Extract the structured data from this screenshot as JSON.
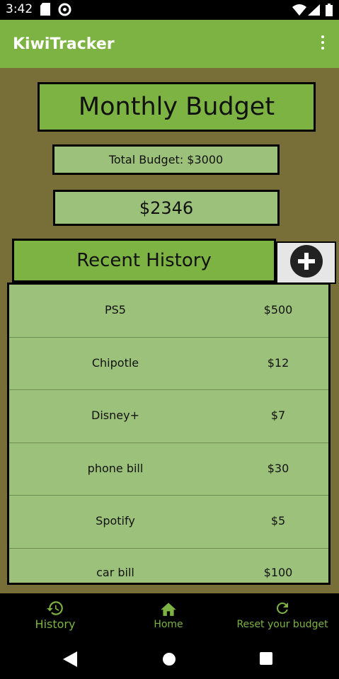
{
  "status_bar": {
    "time": "3:42",
    "icons": [
      "sd-card-icon",
      "data-saver-icon",
      "wifi-icon",
      "signal-icon",
      "battery-icon"
    ]
  },
  "app_bar": {
    "title": "KiwiTracker",
    "menu_icon": "more-vert-icon"
  },
  "budget": {
    "title": "Monthly Budget",
    "total_label": "Total Budget: $3000",
    "remaining": "$2346"
  },
  "history": {
    "header": "Recent History",
    "add_icon": "add-circle-icon",
    "items": [
      {
        "name": "PS5",
        "amount": "$500"
      },
      {
        "name": "Chipotle",
        "amount": "$12"
      },
      {
        "name": "Disney+",
        "amount": "$7"
      },
      {
        "name": "phone bill",
        "amount": "$30"
      },
      {
        "name": "Spotify",
        "amount": "$5"
      },
      {
        "name": "car bill",
        "amount": "$100"
      }
    ]
  },
  "bottom_nav": {
    "items": [
      {
        "label": "History",
        "icon": "history-icon"
      },
      {
        "label": "Home",
        "icon": "home-icon"
      },
      {
        "label": "Reset your budget",
        "icon": "refresh-icon"
      }
    ]
  },
  "colors": {
    "background": "#786e38",
    "accent": "#7cb342",
    "light_green": "#9cc17a"
  }
}
